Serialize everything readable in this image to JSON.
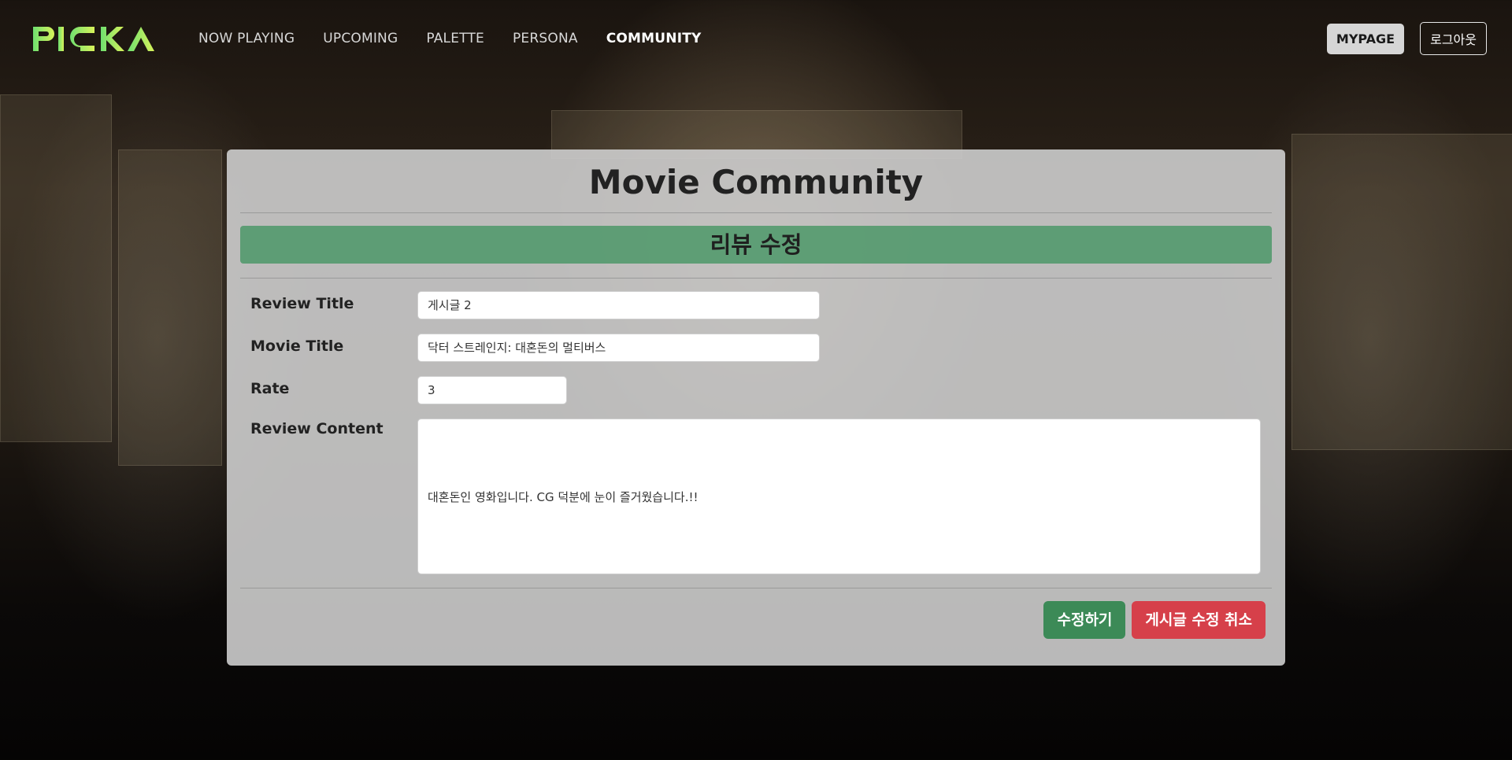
{
  "nav": {
    "logo_text": "PICKA",
    "links": [
      {
        "label": "NOW PLAYING",
        "active": false
      },
      {
        "label": "UPCOMING",
        "active": false
      },
      {
        "label": "PALETTE",
        "active": false
      },
      {
        "label": "PERSONA",
        "active": false
      },
      {
        "label": "COMMUNITY",
        "active": true
      }
    ],
    "mypage_label": "MYPAGE",
    "logout_label": "로그아웃"
  },
  "panel": {
    "title": "Movie Community",
    "section_title": "리뷰 수정",
    "fields": {
      "review_title": {
        "label": "Review Title",
        "value": "게시글 2"
      },
      "movie_title": {
        "label": "Movie Title",
        "value": "닥터 스트레인지: 대혼돈의 멀티버스"
      },
      "rate": {
        "label": "Rate",
        "value": "3"
      },
      "review_content": {
        "label": "Review Content",
        "value": "대혼돈인 영화입니다. CG 덕분에 눈이 즐거웠습니다.!!"
      }
    },
    "submit_label": "수정하기",
    "cancel_label": "게시글 수정 취소"
  },
  "colors": {
    "logo_gradient_start": "#6fe06f",
    "logo_gradient_end": "#d8f25a",
    "section_bar": "#4c9868",
    "submit_button": "#3c8a57",
    "cancel_button": "#d6404a"
  }
}
